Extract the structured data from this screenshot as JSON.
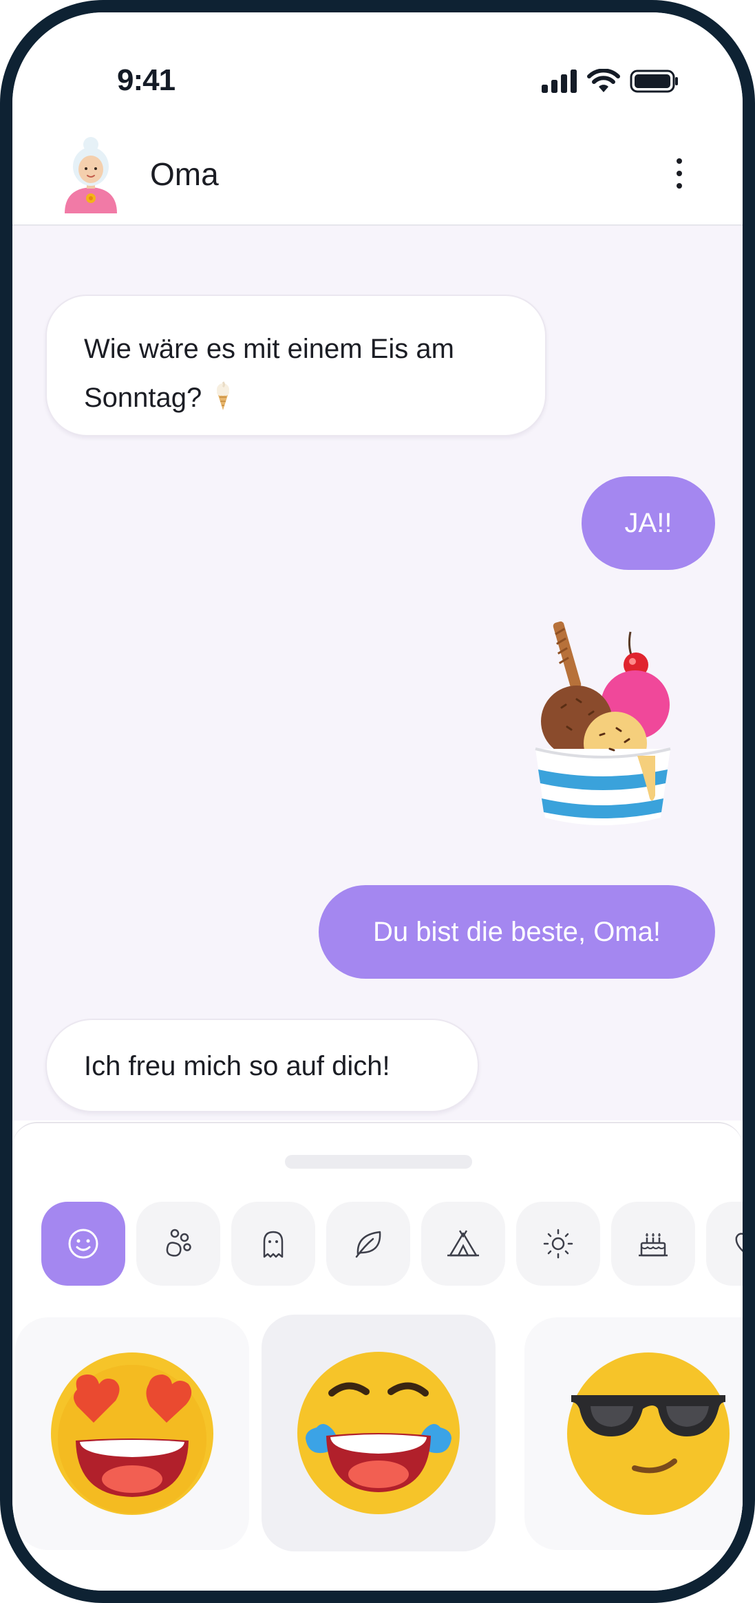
{
  "status_bar": {
    "time": "9:41"
  },
  "header": {
    "contact_name": "Oma"
  },
  "messages": [
    {
      "direction": "in",
      "lines": [
        "Wie wäre es mit einem Eis am",
        "Sonntag?"
      ]
    },
    {
      "direction": "out",
      "text": "JA!!"
    },
    {
      "direction": "out",
      "sticker": "ice-cream-sundae-sticker"
    },
    {
      "direction": "out",
      "text": "Du bist die beste, Oma!"
    },
    {
      "direction": "in",
      "text": "Ich freu mich so auf dich!"
    }
  ],
  "emoji_picker": {
    "categories": [
      "smiley-icon",
      "paw-icon",
      "ghost-icon",
      "leaf-icon",
      "tent-icon",
      "sun-icon",
      "cake-icon",
      "heart-icon"
    ],
    "active_category": "smiley-icon",
    "stickers": [
      "heart-eyes-emoji",
      "tears-of-joy-emoji",
      "sunglasses-emoji"
    ]
  },
  "colors": {
    "accent": "#a487f0",
    "chat_bg": "#f7f4fb",
    "frame": "#0e2233"
  }
}
